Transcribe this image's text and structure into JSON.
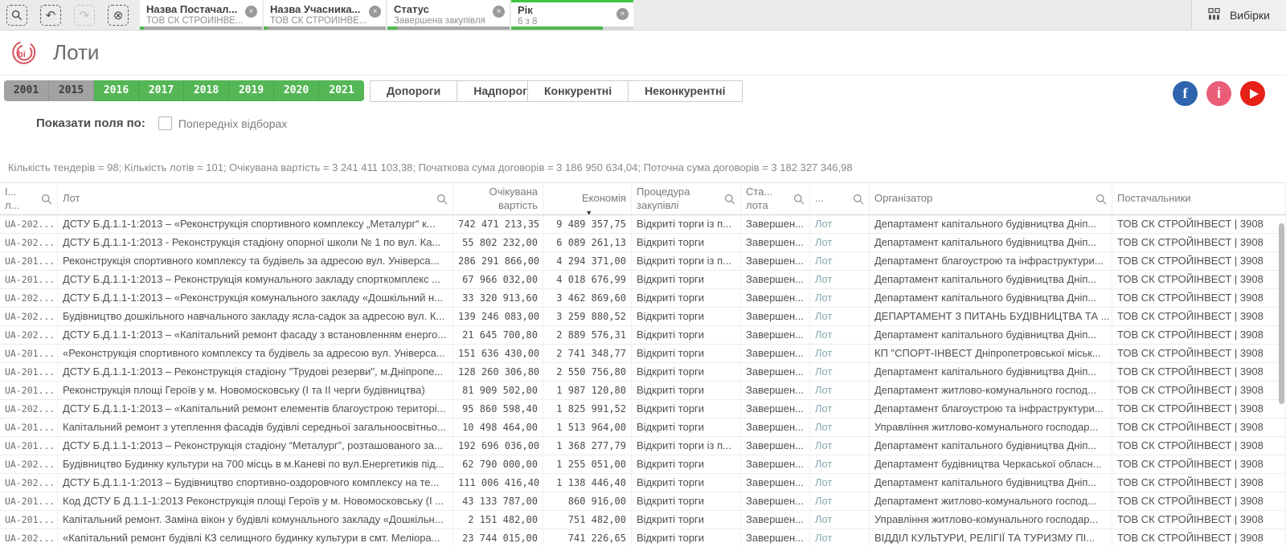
{
  "toolbar": {
    "selections_label": "Вибірки",
    "selections": [
      {
        "title": "Назва Постачал...",
        "value": "ТОВ СК СТРОЙІНВЕ...",
        "selected_ratio": 0.03,
        "active": false,
        "excluded_light": false
      },
      {
        "title": "Назва Учасника...",
        "value": "ТОВ СК СТРОЙІНВЕ...",
        "selected_ratio": 0.03,
        "active": false,
        "excluded_light": false
      },
      {
        "title": "Статус",
        "value": "Завершена закупівля",
        "selected_ratio": 0.08,
        "active": false,
        "excluded_light": false
      },
      {
        "title": "Рік",
        "value": "6 з 8",
        "selected_ratio": 0.75,
        "active": true,
        "excluded_light": true
      }
    ]
  },
  "header": {
    "title": "Лоти",
    "logo_text": "bi"
  },
  "controls": {
    "years": [
      {
        "label": "2001",
        "selected": false
      },
      {
        "label": "2015",
        "selected": false
      },
      {
        "label": "2016",
        "selected": true
      },
      {
        "label": "2017",
        "selected": true
      },
      {
        "label": "2018",
        "selected": true
      },
      {
        "label": "2019",
        "selected": true
      },
      {
        "label": "2020",
        "selected": true
      },
      {
        "label": "2021",
        "selected": true
      }
    ],
    "threshold_buttons": [
      "Допороги",
      "Надпороги"
    ],
    "competition_buttons": [
      "Конкурентні",
      "Неконкурентні"
    ]
  },
  "show_fields": {
    "label": "Показати поля по:",
    "checkbox_label": "Попередніх відборах",
    "checked": false
  },
  "summary": "Кількість тендерів = 98; Кількість лотів = 101; Очікувана вартість = 3 241 411 103,38; Початкова сума договорів = 3 186 950 634,04; Поточна сума договорів = 3 182 327 346,98",
  "table": {
    "columns": [
      {
        "key": "id",
        "label": "І...\nл...",
        "search": true,
        "align": "left"
      },
      {
        "key": "lot",
        "label": "Лот",
        "search": true,
        "align": "left"
      },
      {
        "key": "expected_value",
        "label": "Очікувана\nвартість",
        "search": false,
        "align": "right"
      },
      {
        "key": "savings",
        "label": "Економія",
        "search": false,
        "align": "right",
        "sorted": "desc"
      },
      {
        "key": "procedure",
        "label": "Процедура\nзакупівлі",
        "search": true,
        "align": "left"
      },
      {
        "key": "lot_status",
        "label": "Ста...\nлота",
        "search": true,
        "align": "left"
      },
      {
        "key": "link",
        "label": "...",
        "search": true,
        "align": "left"
      },
      {
        "key": "organizer",
        "label": "Організатор",
        "search": true,
        "align": "left"
      },
      {
        "key": "suppliers",
        "label": "Постачальники",
        "search": false,
        "align": "left"
      }
    ],
    "rows": [
      {
        "id": "UA-202...",
        "lot": "ДСТУ Б.Д.1.1-1:2013 – «Реконструкція спортивного комплексу „Металург“ к...",
        "expected_value": "742 471 213,35",
        "savings": "9 489 357,75",
        "procedure": "Відкриті торги із п...",
        "lot_status": "Завершен...",
        "link": "Лот",
        "organizer": "Департамент капітального будівництва Дніп...",
        "suppliers": "ТОВ СК СТРОЙІНВЕСТ | 3908"
      },
      {
        "id": "UA-202...",
        "lot": "ДСТУ Б.Д.1.1-1:2013 - Реконструкція стадіону опорної школи № 1 по вул. Ка...",
        "expected_value": "55 802 232,00",
        "savings": "6 089 261,13",
        "procedure": "Відкриті торги",
        "lot_status": "Завершен...",
        "link": "Лот",
        "organizer": "Департамент капітального будівництва Дніп...",
        "suppliers": "ТОВ СК СТРОЙІНВЕСТ | 3908"
      },
      {
        "id": "UA-201...",
        "lot": "Реконструкція спортивного комплексу та будівель за адресою вул. Універса...",
        "expected_value": "286 291 866,00",
        "savings": "4 294 371,00",
        "procedure": "Відкриті торги із п...",
        "lot_status": "Завершен...",
        "link": "Лот",
        "organizer": "Департамент благоустрою та інфраструктури...",
        "suppliers": "ТОВ СК СТРОЙІНВЕСТ | 3908"
      },
      {
        "id": "UA-201...",
        "lot": "ДСТУ Б.Д.1.1-1:2013 – Реконструкція комунального закладу спорткомплекс ...",
        "expected_value": "67 966 032,00",
        "savings": "4 018 676,99",
        "procedure": "Відкриті торги",
        "lot_status": "Завершен...",
        "link": "Лот",
        "organizer": "Департамент капітального будівництва Дніп...",
        "suppliers": "ТОВ СК СТРОЙІНВЕСТ | 3908"
      },
      {
        "id": "UA-202...",
        "lot": "ДСТУ Б.Д.1.1-1:2013 – «Реконструкція комунального закладу «Дошкільний н...",
        "expected_value": "33 320 913,60",
        "savings": "3 462 869,60",
        "procedure": "Відкриті торги",
        "lot_status": "Завершен...",
        "link": "Лот",
        "organizer": "Департамент капітального будівництва Дніп...",
        "suppliers": "ТОВ СК СТРОЙІНВЕСТ | 3908"
      },
      {
        "id": "UA-202...",
        "lot": "Будівництво дошкільного навчального закладу ясла-садок за адресою вул. К...",
        "expected_value": "139 246 083,00",
        "savings": "3 259 880,52",
        "procedure": "Відкриті торги",
        "lot_status": "Завершен...",
        "link": "Лот",
        "organizer": "ДЕПАРТАМЕНТ З ПИТАНЬ БУДІВНИЦТВА ТА ...",
        "suppliers": "ТОВ СК СТРОЙІНВЕСТ | 3908"
      },
      {
        "id": "UA-202...",
        "lot": "ДСТУ Б.Д.1.1-1:2013 – «Капітальний ремонт фасаду з встановленням енерго...",
        "expected_value": "21 645 700,80",
        "savings": "2 889 576,31",
        "procedure": "Відкриті торги",
        "lot_status": "Завершен...",
        "link": "Лот",
        "organizer": "Департамент капітального будівництва Дніп...",
        "suppliers": "ТОВ СК СТРОЙІНВЕСТ | 3908"
      },
      {
        "id": "UA-201...",
        "lot": "«Реконструкція спортивного комплексу та будівель за адресою вул. Універса...",
        "expected_value": "151 636 430,00",
        "savings": "2 741 348,77",
        "procedure": "Відкриті торги",
        "lot_status": "Завершен...",
        "link": "Лот",
        "organizer": "КП \"СПОРТ-ІНВЕСТ Дніпропетровської міськ...",
        "suppliers": "ТОВ СК СТРОЙІНВЕСТ | 3908"
      },
      {
        "id": "UA-201...",
        "lot": "ДСТУ Б.Д.1.1-1:2013 – Реконструкція стадіону \"Трудові резерви\", м.Дніпропе...",
        "expected_value": "128 260 306,80",
        "savings": "2 550 756,80",
        "procedure": "Відкриті торги",
        "lot_status": "Завершен...",
        "link": "Лот",
        "organizer": "Департамент капітального будівництва Дніп...",
        "suppliers": "ТОВ СК СТРОЙІНВЕСТ | 3908"
      },
      {
        "id": "UA-201...",
        "lot": "Реконструкція площі Героїв у м. Новомосковську (І та ІІ черги будівництва)",
        "expected_value": "81 909 502,00",
        "savings": "1 987 120,80",
        "procedure": "Відкриті торги",
        "lot_status": "Завершен...",
        "link": "Лот",
        "organizer": "Департамент житлово-комунального господ...",
        "suppliers": "ТОВ СК СТРОЙІНВЕСТ | 3908"
      },
      {
        "id": "UA-202...",
        "lot": "ДСТУ Б.Д.1.1-1:2013 – «Капітальний ремонт елементів благоустрою територі...",
        "expected_value": "95 860 598,40",
        "savings": "1 825 991,52",
        "procedure": "Відкриті торги",
        "lot_status": "Завершен...",
        "link": "Лот",
        "organizer": "Департамент благоустрою та інфраструктури...",
        "suppliers": "ТОВ СК СТРОЙІНВЕСТ | 3908"
      },
      {
        "id": "UA-201...",
        "lot": "Капітальний ремонт з утеплення фасадів будівлі середньої загальноосвітньо...",
        "expected_value": "10 498 464,00",
        "savings": "1 513 964,00",
        "procedure": "Відкриті торги",
        "lot_status": "Завершен...",
        "link": "Лот",
        "organizer": "Управління житлово-комунального господар...",
        "suppliers": "ТОВ СК СТРОЙІНВЕСТ | 3908"
      },
      {
        "id": "UA-201...",
        "lot": "ДСТУ Б.Д.1.1-1:2013 – Реконструкція стадіону “Металург”, розташованого за...",
        "expected_value": "192 696 036,00",
        "savings": "1 368 277,79",
        "procedure": "Відкриті торги із п...",
        "lot_status": "Завершен...",
        "link": "Лот",
        "organizer": "Департамент капітального будівництва Дніп...",
        "suppliers": "ТОВ СК СТРОЙІНВЕСТ | 3908"
      },
      {
        "id": "UA-202...",
        "lot": "Будівництво Будинку культури на 700 місць в м.Каневі по вул.Енергетиків під...",
        "expected_value": "62 790 000,00",
        "savings": "1 255 051,00",
        "procedure": "Відкриті торги",
        "lot_status": "Завершен...",
        "link": "Лот",
        "organizer": "Департамент будівництва Черкаської обласн...",
        "suppliers": "ТОВ СК СТРОЙІНВЕСТ | 3908"
      },
      {
        "id": "UA-202...",
        "lot": "ДСТУ Б.Д.1.1-1:2013 – Будівництво спортивно-оздоровчого комплексу на те...",
        "expected_value": "111 006 416,40",
        "savings": "1 138 446,40",
        "procedure": "Відкриті торги",
        "lot_status": "Завершен...",
        "link": "Лот",
        "organizer": "Департамент капітального будівництва Дніп...",
        "suppliers": "ТОВ СК СТРОЙІНВЕСТ | 3908"
      },
      {
        "id": "UA-201...",
        "lot": "Код ДСТУ Б Д.1.1-1:2013 Реконструкція площі Героїв у м. Новомосковську (І ...",
        "expected_value": "43 133 787,00",
        "savings": "860 916,00",
        "procedure": "Відкриті торги",
        "lot_status": "Завершен...",
        "link": "Лот",
        "organizer": "Департамент житлово-комунального господ...",
        "suppliers": "ТОВ СК СТРОЙІНВЕСТ | 3908"
      },
      {
        "id": "UA-201...",
        "lot": "Капітальний ремонт. Заміна вікон у будівлі комунального закладу «Дошкільн...",
        "expected_value": "2 151 482,00",
        "savings": "751 482,00",
        "procedure": "Відкриті торги",
        "lot_status": "Завершен...",
        "link": "Лот",
        "organizer": "Управління житлово-комунального господар...",
        "suppliers": "ТОВ СК СТРОЙІНВЕСТ | 3908"
      },
      {
        "id": "UA-202...",
        "lot": "«Капітальний ремонт будівлі КЗ селищного будинку культури в смт. Меліора...",
        "expected_value": "23 744 015,00",
        "savings": "741 226,65",
        "procedure": "Відкриті торги",
        "lot_status": "Завершен...",
        "link": "Лот",
        "organizer": "ВІДДІЛ КУЛЬТУРИ, РЕЛІГІЇ ТА ТУРИЗМУ ПІ...",
        "suppliers": "ТОВ СК СТРОЙІНВЕСТ | 3908"
      }
    ]
  }
}
